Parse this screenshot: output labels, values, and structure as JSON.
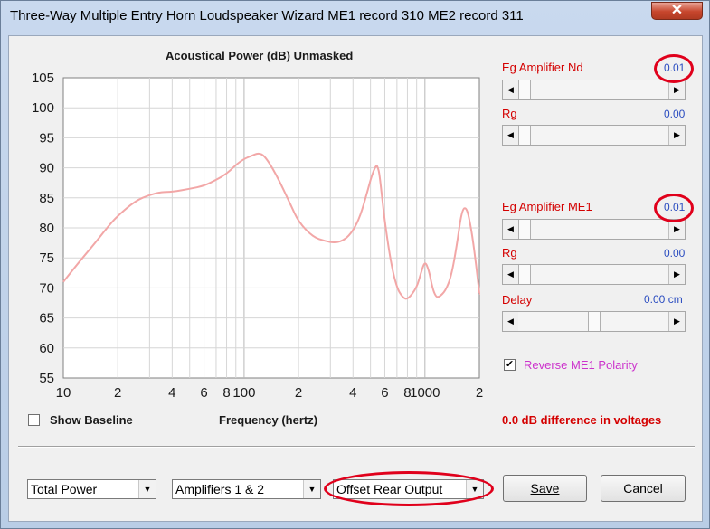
{
  "window": {
    "title": "Three-Way Multiple Entry Horn Loudspeaker Wizard    ME1 record 310    ME2 record 311",
    "close_label": "✕"
  },
  "chart": {
    "title": "Acoustical Power (dB)   Unmasked",
    "xlabel": "Frequency (hertz)"
  },
  "chart_data": {
    "type": "line",
    "title": "Acoustical Power (dB)   Unmasked",
    "xlabel": "Frequency (hertz)",
    "ylabel": "",
    "x_scale": "log",
    "xlim": [
      10,
      2000
    ],
    "ylim": [
      55,
      105
    ],
    "grid": true,
    "y_ticks": [
      "105",
      "100",
      "95",
      "90",
      "85",
      "80",
      "75",
      "70",
      "65",
      "60",
      "55"
    ],
    "x_ticks": [
      {
        "v": 10,
        "label": "10"
      },
      {
        "v": 20,
        "label": "2"
      },
      {
        "v": 40,
        "label": "4"
      },
      {
        "v": 60,
        "label": "6"
      },
      {
        "v": 80,
        "label": "8"
      },
      {
        "v": 100,
        "label": "100"
      },
      {
        "v": 200,
        "label": "2"
      },
      {
        "v": 400,
        "label": "4"
      },
      {
        "v": 600,
        "label": "6"
      },
      {
        "v": 800,
        "label": "8"
      },
      {
        "v": 1000,
        "label": "1000"
      },
      {
        "v": 2000,
        "label": "2"
      }
    ],
    "series": [
      {
        "color": "#f2a7a7",
        "x": [
          10,
          12,
          15,
          18,
          20,
          25,
          30,
          35,
          40,
          50,
          60,
          70,
          80,
          90,
          100,
          110,
          120,
          130,
          150,
          180,
          200,
          240,
          280,
          320,
          360,
          400,
          440,
          480,
          500,
          520,
          540,
          550,
          560,
          580,
          600,
          650,
          700,
          750,
          800,
          900,
          950,
          1000,
          1050,
          1100,
          1150,
          1200,
          1300,
          1400,
          1500,
          1600,
          1700,
          1800,
          1900,
          2000
        ],
        "y": [
          71,
          74,
          77.5,
          80.5,
          82,
          84.5,
          85.5,
          86,
          86,
          86.5,
          87,
          88,
          89,
          90.5,
          91.5,
          92,
          92.5,
          92,
          89,
          84,
          81,
          78.5,
          77.8,
          77.5,
          78,
          79.5,
          82,
          86,
          88,
          89.5,
          90.5,
          90,
          89,
          85,
          81,
          74,
          70,
          68.5,
          68,
          70,
          72.5,
          74.5,
          73,
          70,
          68.5,
          68.5,
          69.5,
          72,
          77,
          83,
          83.5,
          80,
          75,
          69
        ]
      }
    ]
  },
  "controls": {
    "eg_amp_nd_label": "Eg  Amplifier  Nd",
    "eg_amp_nd_value": "0.01",
    "rg1_label": "Rg",
    "rg1_value": "0.00",
    "eg_amp_me1_label": "Eg  Amplifier  ME1",
    "eg_amp_me1_value": "0.01",
    "rg2_label": "Rg",
    "rg2_value": "0.00",
    "delay_label": "Delay",
    "delay_value": "0.00 cm",
    "reverse_label": "Reverse ME1 Polarity",
    "reverse_checked": true,
    "show_baseline_label": "Show Baseline",
    "voltage_diff": "0.0 dB difference in voltages"
  },
  "bottom": {
    "combo1": "Total Power",
    "combo2": "Amplifiers 1 & 2",
    "combo3": "Offset Rear Output",
    "save_label": "Save",
    "cancel_label": "Cancel"
  },
  "colors": {
    "accent_red": "#d40000",
    "value_blue": "#2a4cc0",
    "magenta": "#cc33cc",
    "curve": "#f2a7a7",
    "highlight": "#e0001b"
  }
}
